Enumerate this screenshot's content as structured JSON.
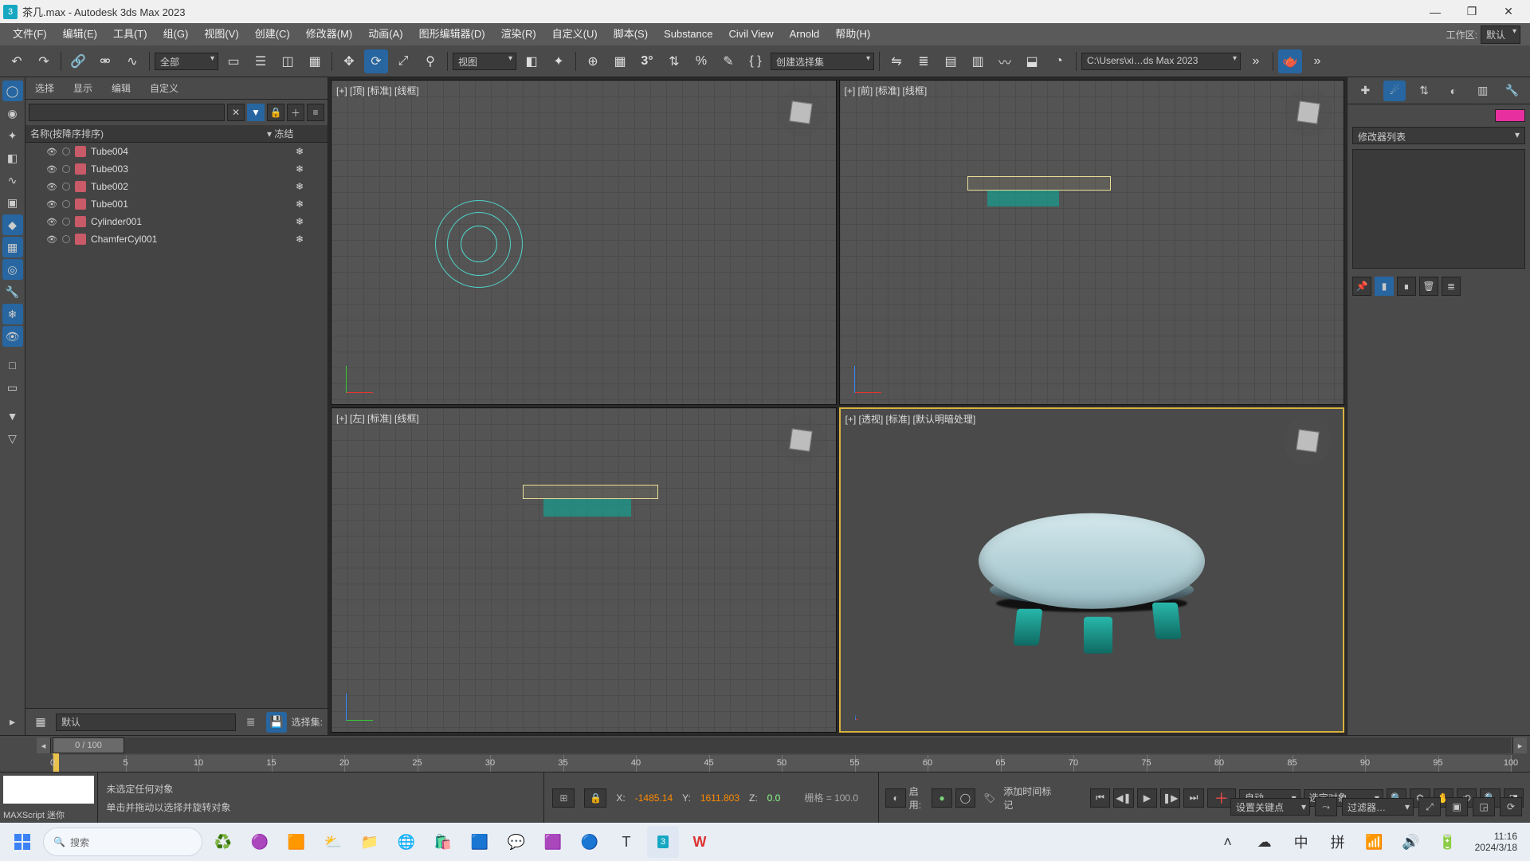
{
  "title": "茶几.max - Autodesk 3ds Max 2023",
  "window": {
    "min": "—",
    "max": "❐",
    "close": "✕"
  },
  "menus": [
    "文件(F)",
    "编辑(E)",
    "工具(T)",
    "组(G)",
    "视图(V)",
    "创建(C)",
    "修改器(M)",
    "动画(A)",
    "图形编辑器(D)",
    "渲染(R)",
    "自定义(U)",
    "脚本(S)",
    "Substance",
    "Civil View",
    "Arnold",
    "帮助(H)"
  ],
  "workspace": {
    "label": "工作区:",
    "value": "默认"
  },
  "toolbar": {
    "filter_dd": "全部",
    "view_dd": "视图",
    "selset_dd": "创建选择集",
    "path_dd": "C:\\Users\\xi…ds Max 2023"
  },
  "scene": {
    "tabs": [
      "选择",
      "显示",
      "编辑",
      "自定义"
    ],
    "header": {
      "name": "名称(按降序排序)",
      "frozen": "▾ 冻结"
    },
    "items": [
      {
        "name": "Tube004"
      },
      {
        "name": "Tube003"
      },
      {
        "name": "Tube002"
      },
      {
        "name": "Tube001"
      },
      {
        "name": "Cylinder001"
      },
      {
        "name": "ChamferCyl001"
      }
    ],
    "bottom": {
      "default": "默认",
      "label": "选择集:"
    }
  },
  "viewports": {
    "top": "[+] [顶] [标准] [线框]",
    "front": "[+] [前] [标准] [线框]",
    "left": "[+] [左] [标准] [线框]",
    "persp": "[+] [透视] [标准] [默认明暗处理]"
  },
  "cmd": {
    "mod_dd": "修改器列表"
  },
  "timeline": {
    "knob": "0 / 100",
    "ticks": [
      0,
      5,
      10,
      15,
      20,
      25,
      30,
      35,
      40,
      45,
      50,
      55,
      60,
      65,
      70,
      75,
      80,
      85,
      90,
      95,
      100
    ]
  },
  "status": {
    "script": "MAXScript 迷你",
    "line1": "未选定任何对象",
    "line2": "单击并拖动以选择并旋转对象",
    "x_lbl": "X:",
    "x": "-1485.14",
    "y_lbl": "Y:",
    "y": "1611.803",
    "z_lbl": "Z:",
    "z": "0.0",
    "grid": "栅格 = 100.0",
    "enable": "启用:",
    "addtime": "添加时间标记",
    "auto": "自动",
    "selobj": "选定对象",
    "setkey": "设置关键点",
    "filter": "过滤器…"
  },
  "taskbar": {
    "search_ph": "搜索",
    "time": "11:16",
    "date": "2024/3/18",
    "ime": "中",
    "pin": "拼"
  }
}
